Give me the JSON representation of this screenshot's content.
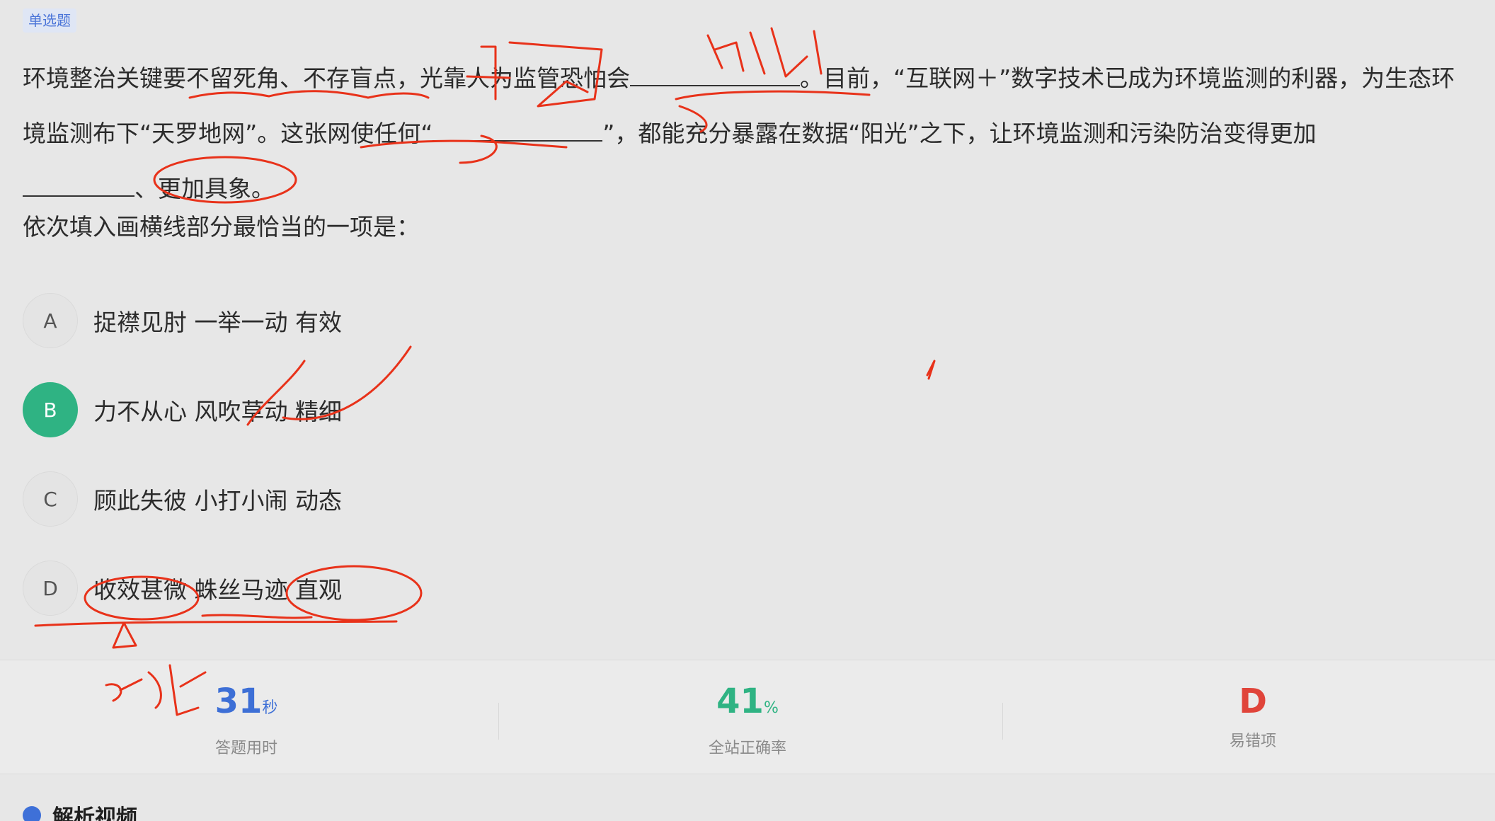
{
  "tag": "单选题",
  "question": {
    "part1": "环境整治关键要不留死角、不存盲点，光靠人为监管恐怕会",
    "part2": "。目前，“互联网＋”数字技术已成为环境监测的利器，为生态环境监测布下“天罗地网”。这张网使任何“",
    "part3": "”，都能充分暴露在数据“阳光”之下，让环境监测和污染防治变得更加",
    "part4": "、更加具象。"
  },
  "prompt": "依次填入画横线部分最恰当的一项是：",
  "options": [
    {
      "letter": "A",
      "text": "捉襟见肘 一举一动 有效",
      "selected": false
    },
    {
      "letter": "B",
      "text": "力不从心 风吹草动 精细",
      "selected": true
    },
    {
      "letter": "C",
      "text": "顾此失彼 小打小闹 动态",
      "selected": false
    },
    {
      "letter": "D",
      "text": "收效甚微 蛛丝马迹 直观",
      "selected": false
    }
  ],
  "stats": [
    {
      "value": "31",
      "unit": "秒",
      "label": "答题用时",
      "color": "#3d6fd6"
    },
    {
      "value": "41",
      "unit": "%",
      "label": "全站正确率",
      "color": "#2fb383"
    },
    {
      "value": "D",
      "unit": "",
      "label": "易错项",
      "color": "#e0443a"
    }
  ],
  "section": {
    "title": "解析视频"
  },
  "colors": {
    "selected": "#2fb383",
    "annotation": "#e8321a",
    "tag_text": "#4a74d8"
  }
}
